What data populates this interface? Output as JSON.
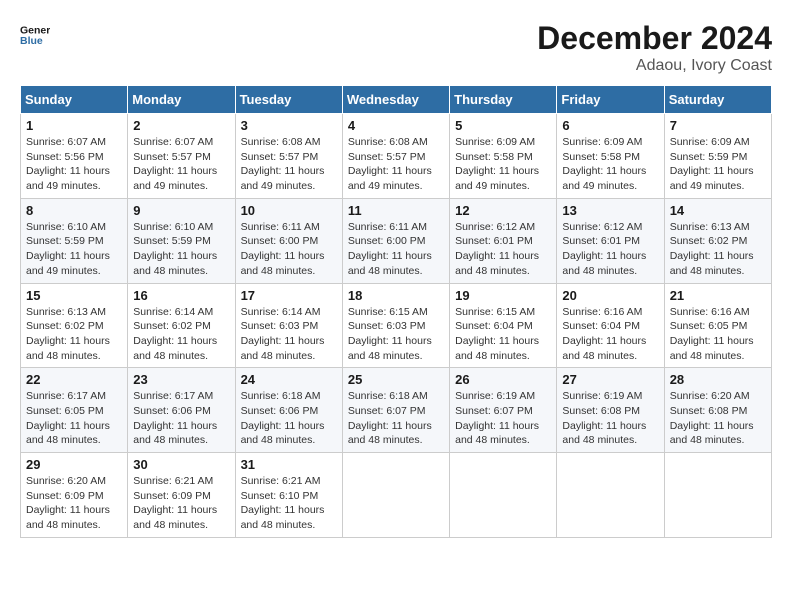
{
  "header": {
    "logo_line1": "General",
    "logo_line2": "Blue",
    "title": "December 2024",
    "subtitle": "Adaou, Ivory Coast"
  },
  "calendar": {
    "days_of_week": [
      "Sunday",
      "Monday",
      "Tuesday",
      "Wednesday",
      "Thursday",
      "Friday",
      "Saturday"
    ],
    "weeks": [
      [
        {
          "day": "1",
          "info": "Sunrise: 6:07 AM\nSunset: 5:56 PM\nDaylight: 11 hours\nand 49 minutes."
        },
        {
          "day": "2",
          "info": "Sunrise: 6:07 AM\nSunset: 5:57 PM\nDaylight: 11 hours\nand 49 minutes."
        },
        {
          "day": "3",
          "info": "Sunrise: 6:08 AM\nSunset: 5:57 PM\nDaylight: 11 hours\nand 49 minutes."
        },
        {
          "day": "4",
          "info": "Sunrise: 6:08 AM\nSunset: 5:57 PM\nDaylight: 11 hours\nand 49 minutes."
        },
        {
          "day": "5",
          "info": "Sunrise: 6:09 AM\nSunset: 5:58 PM\nDaylight: 11 hours\nand 49 minutes."
        },
        {
          "day": "6",
          "info": "Sunrise: 6:09 AM\nSunset: 5:58 PM\nDaylight: 11 hours\nand 49 minutes."
        },
        {
          "day": "7",
          "info": "Sunrise: 6:09 AM\nSunset: 5:59 PM\nDaylight: 11 hours\nand 49 minutes."
        }
      ],
      [
        {
          "day": "8",
          "info": "Sunrise: 6:10 AM\nSunset: 5:59 PM\nDaylight: 11 hours\nand 49 minutes."
        },
        {
          "day": "9",
          "info": "Sunrise: 6:10 AM\nSunset: 5:59 PM\nDaylight: 11 hours\nand 48 minutes."
        },
        {
          "day": "10",
          "info": "Sunrise: 6:11 AM\nSunset: 6:00 PM\nDaylight: 11 hours\nand 48 minutes."
        },
        {
          "day": "11",
          "info": "Sunrise: 6:11 AM\nSunset: 6:00 PM\nDaylight: 11 hours\nand 48 minutes."
        },
        {
          "day": "12",
          "info": "Sunrise: 6:12 AM\nSunset: 6:01 PM\nDaylight: 11 hours\nand 48 minutes."
        },
        {
          "day": "13",
          "info": "Sunrise: 6:12 AM\nSunset: 6:01 PM\nDaylight: 11 hours\nand 48 minutes."
        },
        {
          "day": "14",
          "info": "Sunrise: 6:13 AM\nSunset: 6:02 PM\nDaylight: 11 hours\nand 48 minutes."
        }
      ],
      [
        {
          "day": "15",
          "info": "Sunrise: 6:13 AM\nSunset: 6:02 PM\nDaylight: 11 hours\nand 48 minutes."
        },
        {
          "day": "16",
          "info": "Sunrise: 6:14 AM\nSunset: 6:02 PM\nDaylight: 11 hours\nand 48 minutes."
        },
        {
          "day": "17",
          "info": "Sunrise: 6:14 AM\nSunset: 6:03 PM\nDaylight: 11 hours\nand 48 minutes."
        },
        {
          "day": "18",
          "info": "Sunrise: 6:15 AM\nSunset: 6:03 PM\nDaylight: 11 hours\nand 48 minutes."
        },
        {
          "day": "19",
          "info": "Sunrise: 6:15 AM\nSunset: 6:04 PM\nDaylight: 11 hours\nand 48 minutes."
        },
        {
          "day": "20",
          "info": "Sunrise: 6:16 AM\nSunset: 6:04 PM\nDaylight: 11 hours\nand 48 minutes."
        },
        {
          "day": "21",
          "info": "Sunrise: 6:16 AM\nSunset: 6:05 PM\nDaylight: 11 hours\nand 48 minutes."
        }
      ],
      [
        {
          "day": "22",
          "info": "Sunrise: 6:17 AM\nSunset: 6:05 PM\nDaylight: 11 hours\nand 48 minutes."
        },
        {
          "day": "23",
          "info": "Sunrise: 6:17 AM\nSunset: 6:06 PM\nDaylight: 11 hours\nand 48 minutes."
        },
        {
          "day": "24",
          "info": "Sunrise: 6:18 AM\nSunset: 6:06 PM\nDaylight: 11 hours\nand 48 minutes."
        },
        {
          "day": "25",
          "info": "Sunrise: 6:18 AM\nSunset: 6:07 PM\nDaylight: 11 hours\nand 48 minutes."
        },
        {
          "day": "26",
          "info": "Sunrise: 6:19 AM\nSunset: 6:07 PM\nDaylight: 11 hours\nand 48 minutes."
        },
        {
          "day": "27",
          "info": "Sunrise: 6:19 AM\nSunset: 6:08 PM\nDaylight: 11 hours\nand 48 minutes."
        },
        {
          "day": "28",
          "info": "Sunrise: 6:20 AM\nSunset: 6:08 PM\nDaylight: 11 hours\nand 48 minutes."
        }
      ],
      [
        {
          "day": "29",
          "info": "Sunrise: 6:20 AM\nSunset: 6:09 PM\nDaylight: 11 hours\nand 48 minutes."
        },
        {
          "day": "30",
          "info": "Sunrise: 6:21 AM\nSunset: 6:09 PM\nDaylight: 11 hours\nand 48 minutes."
        },
        {
          "day": "31",
          "info": "Sunrise: 6:21 AM\nSunset: 6:10 PM\nDaylight: 11 hours\nand 48 minutes."
        },
        {
          "day": "",
          "info": ""
        },
        {
          "day": "",
          "info": ""
        },
        {
          "day": "",
          "info": ""
        },
        {
          "day": "",
          "info": ""
        }
      ]
    ]
  }
}
